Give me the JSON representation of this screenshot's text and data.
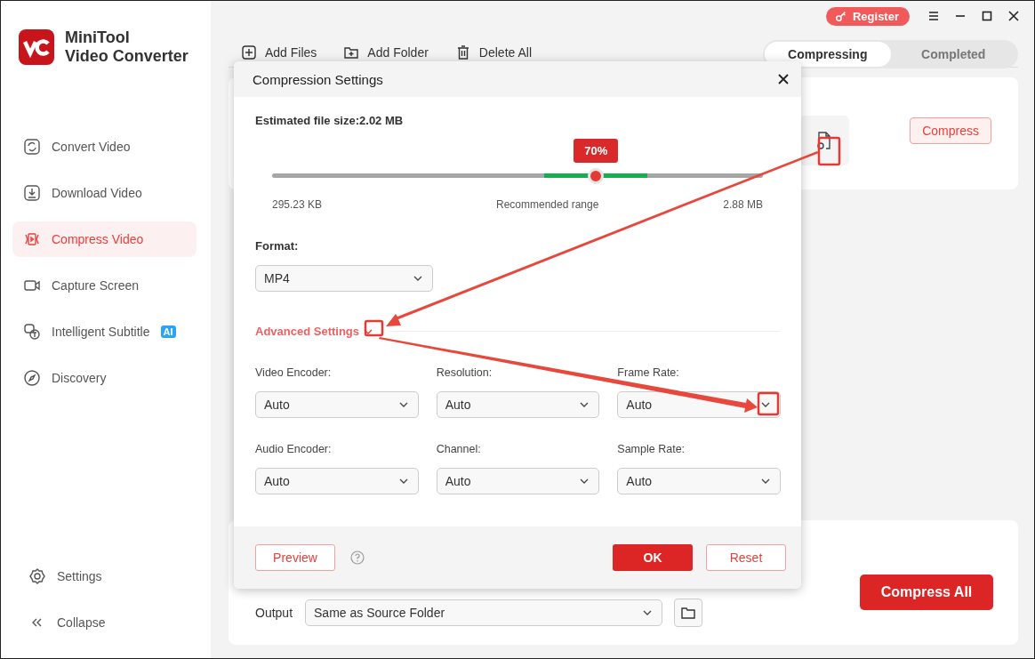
{
  "app": {
    "name": [
      "MiniTool",
      "Video Converter"
    ]
  },
  "sidebar": {
    "items": [
      {
        "label": "Convert Video",
        "kind": "convert",
        "selected": false
      },
      {
        "label": "Download Video",
        "kind": "download",
        "selected": false
      },
      {
        "label": "Compress Video",
        "kind": "compress",
        "selected": true
      },
      {
        "label": "Capture Screen",
        "kind": "capture",
        "selected": false
      },
      {
        "label": "Intelligent Subtitle",
        "kind": "subtitle",
        "selected": false,
        "badge": "AI"
      },
      {
        "label": "Discovery",
        "kind": "discovery",
        "selected": false
      }
    ],
    "footer": [
      {
        "label": "Settings",
        "kind": "settings"
      },
      {
        "label": "Collapse",
        "kind": "collapse"
      }
    ]
  },
  "titlebar": {
    "register": "Register"
  },
  "toolbar": [
    {
      "label": "Add Files",
      "kind": "add-file"
    },
    {
      "label": "Add Folder",
      "kind": "add-folder"
    },
    {
      "label": "Delete All",
      "kind": "delete"
    }
  ],
  "tabs": [
    {
      "label": "Compressing",
      "selected": true
    },
    {
      "label": "Completed",
      "selected": false
    }
  ],
  "file_card": {
    "compress_button": "Compress"
  },
  "dialog": {
    "title": "Compression Settings",
    "estimate": "Estimated file size:2.02 MB",
    "slider": {
      "value_label": "70%",
      "level": 0.66,
      "min": "295.23 KB",
      "middle": "Recommended range",
      "max": "2.88 MB"
    },
    "format": {
      "label": "Format:",
      "value": "MP4"
    },
    "advanced": "Advanced Settings",
    "fields": [
      {
        "label": "Video Encoder:",
        "value": "Auto"
      },
      {
        "label": "Resolution:",
        "value": "Auto"
      },
      {
        "label": "Frame Rate:",
        "value": "Auto"
      },
      {
        "label": "Audio Encoder:",
        "value": "Auto"
      },
      {
        "label": "Channel:",
        "value": "Auto"
      },
      {
        "label": "Sample Rate:",
        "value": "Auto"
      }
    ],
    "buttons": {
      "preview": "Preview",
      "ok": "OK",
      "reset": "Reset"
    }
  },
  "output": {
    "label": "Output",
    "value": "Same as Source Folder",
    "compress_all": "Compress All"
  }
}
